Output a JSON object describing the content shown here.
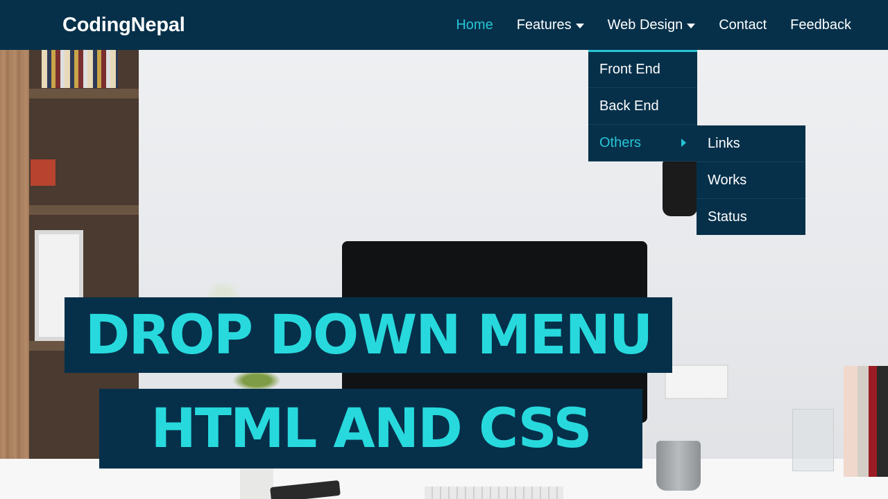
{
  "navbar": {
    "logo": "CodingNepal",
    "links": [
      {
        "label": "Home",
        "active": true,
        "has_caret": false
      },
      {
        "label": "Features",
        "active": false,
        "has_caret": true,
        "caret_icon": "caret-down-icon"
      },
      {
        "label": "Web Design",
        "active": false,
        "has_caret": true,
        "caret_icon": "caret-down-icon"
      },
      {
        "label": "Contact",
        "active": false,
        "has_caret": false
      },
      {
        "label": "Feedback",
        "active": false,
        "has_caret": false
      }
    ]
  },
  "dropdown": {
    "items": [
      {
        "label": "Front End",
        "active": false
      },
      {
        "label": "Back End",
        "active": false
      },
      {
        "label": "Others",
        "active": true,
        "icon": "caret-right-icon"
      }
    ],
    "submenu": [
      {
        "label": "Links"
      },
      {
        "label": "Works"
      },
      {
        "label": "Status"
      }
    ]
  },
  "banner": {
    "line1": "DROP DOWN MENU",
    "line2": "HTML AND CSS"
  },
  "colors": {
    "nav_bg": "#06304a",
    "accent": "#27c6d6",
    "banner_text": "#27d9dd",
    "text": "#ffffff"
  }
}
